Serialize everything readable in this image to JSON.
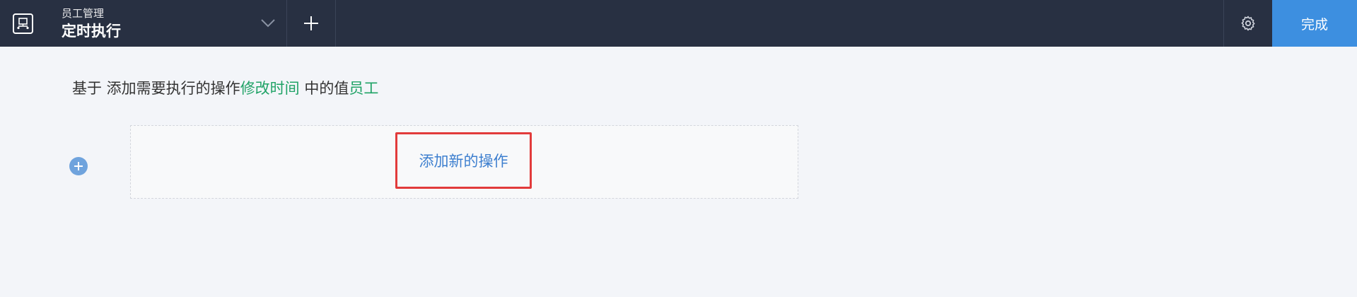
{
  "header": {
    "app_name": "员工管理",
    "page_name": "定时执行",
    "done_label": "完成"
  },
  "sentence": {
    "prefix": "基于 添加需要执行的操作",
    "field": "修改时间",
    "middle": " 中的值",
    "entity": "员工"
  },
  "main": {
    "add_action_label": "添加新的操作"
  },
  "colors": {
    "topbar": "#283042",
    "accent": "#3d8fe0",
    "green_text": "#1fa266",
    "link_blue": "#3d7fcf",
    "highlight_red": "#e23b3b"
  }
}
